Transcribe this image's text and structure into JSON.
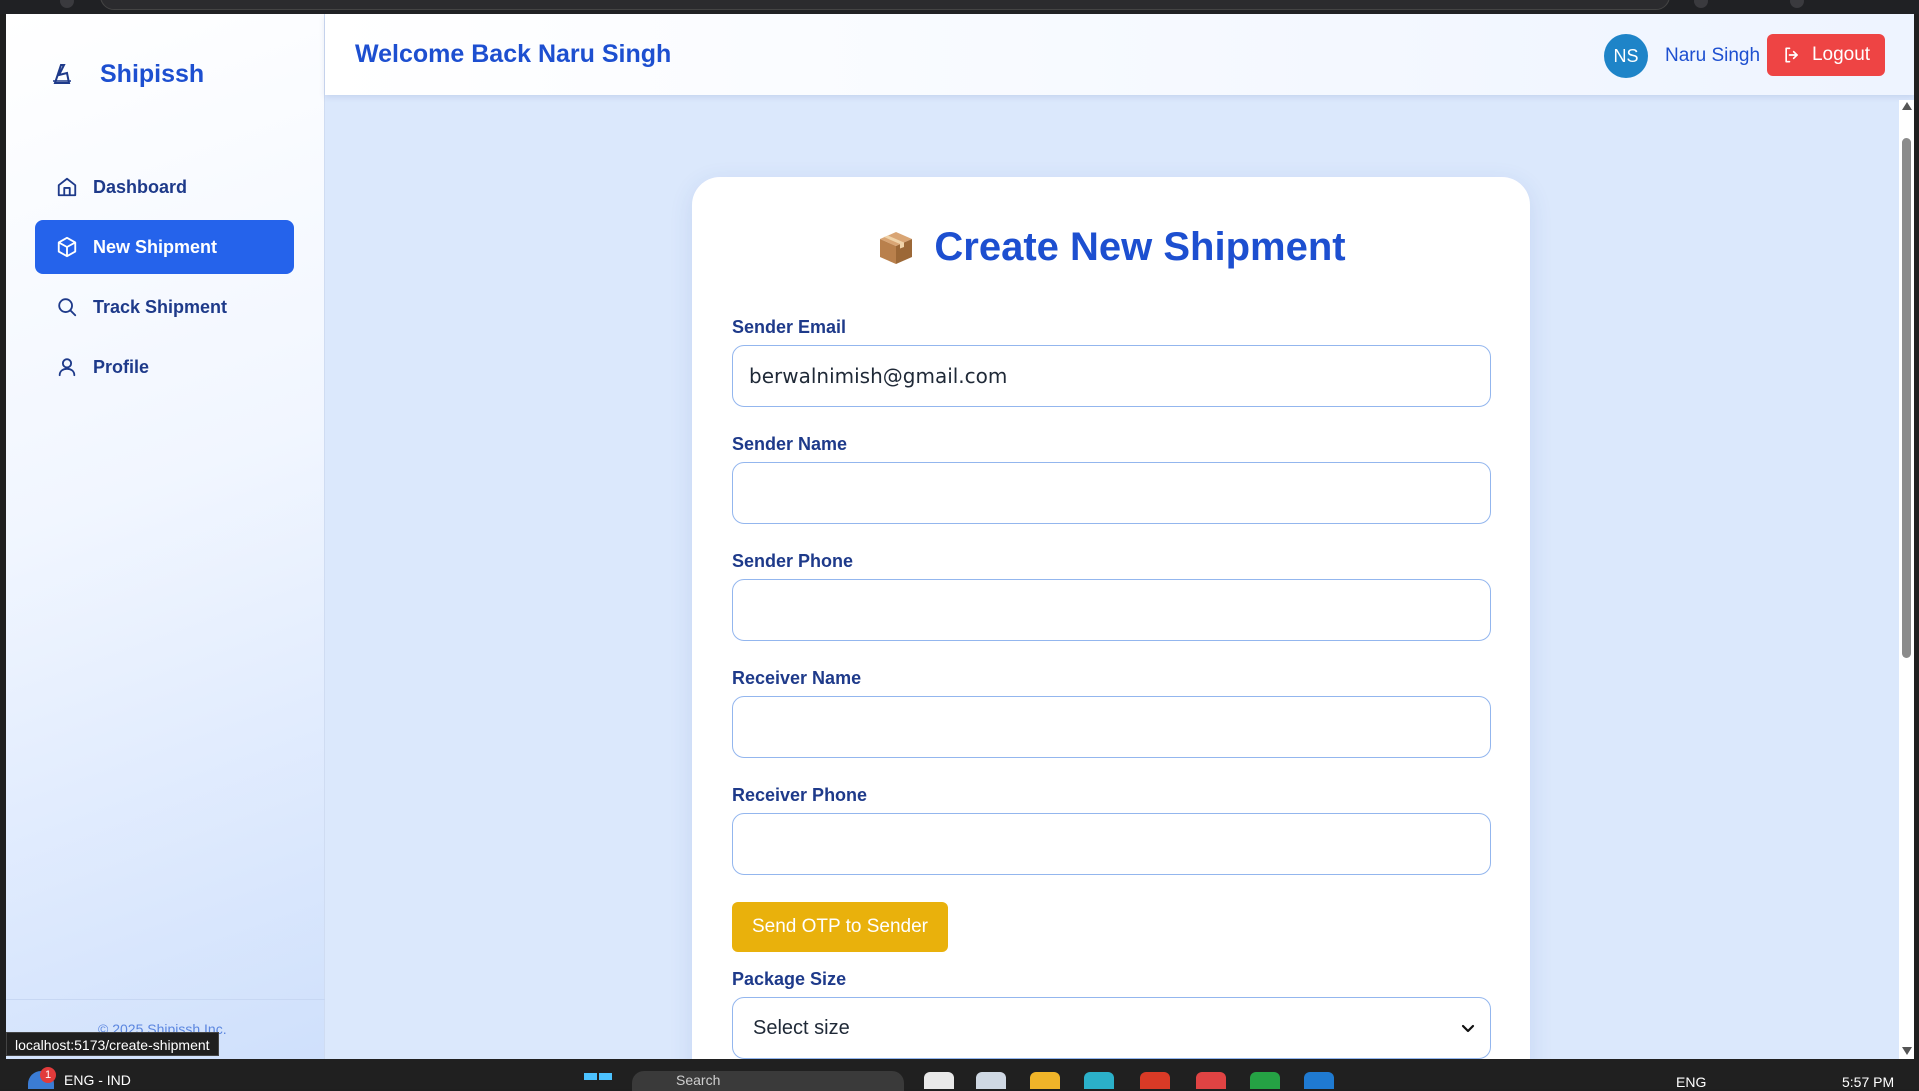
{
  "app": {
    "brand": "Shipissh",
    "copyright": "© 2025 Shipissh Inc.",
    "status_url": "localhost:5173/create-shipment"
  },
  "sidebar": {
    "items": [
      {
        "label": "Dashboard",
        "icon": "home-icon",
        "active": false
      },
      {
        "label": "New Shipment",
        "icon": "package-icon",
        "active": true
      },
      {
        "label": "Track Shipment",
        "icon": "search-icon",
        "active": false
      },
      {
        "label": "Profile",
        "icon": "user-icon",
        "active": false
      }
    ]
  },
  "header": {
    "welcome": "Welcome Back Naru Singh",
    "avatar_initials": "NS",
    "user_name": "Naru Singh",
    "logout_label": "Logout"
  },
  "form": {
    "title": "Create New Shipment",
    "title_icon": "package-emoji-icon",
    "fields": {
      "sender_email": {
        "label": "Sender Email",
        "value": "berwalnimish@gmail.com"
      },
      "sender_name": {
        "label": "Sender Name",
        "value": ""
      },
      "sender_phone": {
        "label": "Sender Phone",
        "value": ""
      },
      "receiver_name": {
        "label": "Receiver Name",
        "value": ""
      },
      "receiver_phone": {
        "label": "Receiver Phone",
        "value": ""
      }
    },
    "otp_button": "Send OTP to Sender",
    "package_size": {
      "label": "Package Size",
      "selected": "Select size"
    }
  },
  "taskbar": {
    "weather_badge": "1",
    "lang": "ENG - IND",
    "search_placeholder": "Search",
    "tray_lang": "ENG",
    "time": "5:57 PM"
  },
  "colors": {
    "primary": "#2563eb",
    "brand_text": "#1d4fd0",
    "logout": "#ee4444",
    "otp_button": "#e9b10c",
    "page_bg": "#dbe8fc",
    "avatar": "#1e84c8"
  }
}
